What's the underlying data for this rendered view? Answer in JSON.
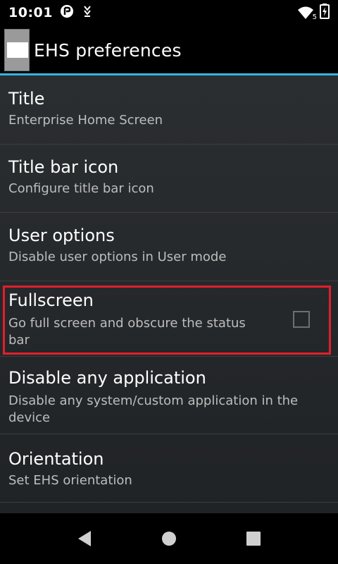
{
  "status_bar": {
    "time": "10:01",
    "icons_left": [
      "notification-icon",
      "download-icon"
    ],
    "icons_right": [
      "wifi-icon",
      "battery-charging-icon"
    ],
    "wifi_badge": "5"
  },
  "action_bar": {
    "title": "EHS preferences",
    "accent_color": "#33b5e5"
  },
  "preferences": [
    {
      "title": "Title",
      "summary": "Enterprise Home Screen"
    },
    {
      "title": "Title bar icon",
      "summary": "Configure title bar icon"
    },
    {
      "title": "User options",
      "summary": "Disable user options in User mode"
    },
    {
      "title": "Fullscreen",
      "summary_line1": "Go full screen and obscure the status",
      "summary_line2": "bar",
      "checked": false,
      "highlighted": true,
      "highlight_color": "#e0202a"
    },
    {
      "title": "Disable any application",
      "summary_line1": "Disable any system/custom application in the",
      "summary_line2": "device"
    },
    {
      "title": "Orientation",
      "summary": "Set EHS orientation"
    }
  ],
  "nav_bar": {
    "buttons": [
      "back-icon",
      "home-icon",
      "recents-icon"
    ]
  }
}
